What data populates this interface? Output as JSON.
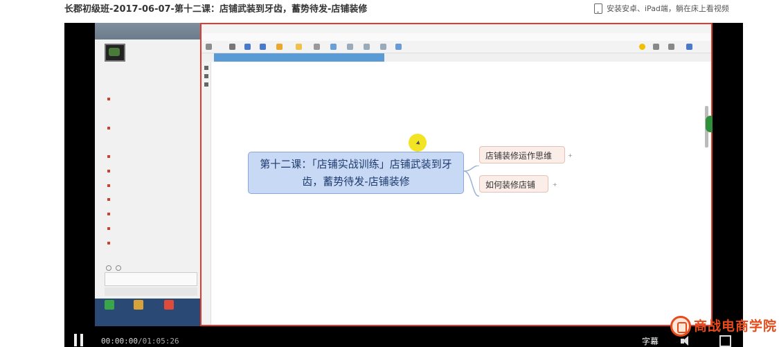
{
  "header": {
    "course_title": "长郡初级班-2017-06-07-第十二课：店铺武装到牙齿，蓄势待发-店铺装修",
    "promo_text": "安装安卓、iPad端，躺在床上看视频",
    "promo_icon": "phone-icon"
  },
  "video": {
    "mindmap": {
      "central_topic": "第十二课：「店铺实战训练」店铺武装到牙齿，蓄势待发-店铺装修",
      "subtopics": [
        {
          "label": "店铺装修运作思维"
        },
        {
          "label": "如何装修店铺"
        }
      ]
    },
    "overlay_colors": {
      "highlight_border": "#e03b2e",
      "central_fill": "#c7d9f5",
      "subtopic_fill": "#fbeee9",
      "cursor_highlight": "#f0e000"
    }
  },
  "player": {
    "current_time": "00:00:00",
    "duration": "/01:05:26",
    "subtitle_label": "字幕",
    "icons": [
      "pause-icon",
      "volume-icon",
      "fullscreen-icon"
    ]
  },
  "watermark": {
    "text": "商战电商学院",
    "color": "#e84a1a"
  }
}
